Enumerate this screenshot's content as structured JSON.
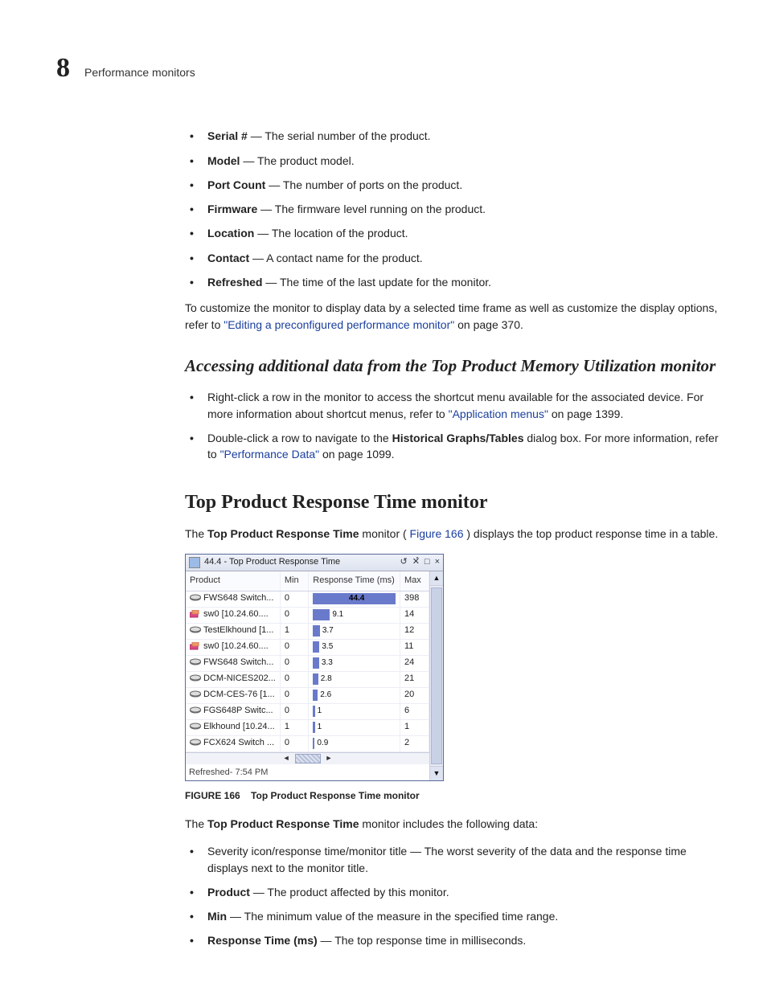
{
  "header": {
    "chapter_number": "8",
    "chapter_title": "Performance monitors"
  },
  "field_list": [
    {
      "term": "Serial #",
      "desc": " — The serial number of the product."
    },
    {
      "term": "Model",
      "desc": " — The product model."
    },
    {
      "term": "Port Count",
      "desc": " — The number of ports on the product."
    },
    {
      "term": "Firmware",
      "desc": " — The firmware level running on the product."
    },
    {
      "term": "Location",
      "desc": " — The location of the product."
    },
    {
      "term": "Contact",
      "desc": " — A contact name for the product."
    },
    {
      "term": "Refreshed",
      "desc": " — The time of the last update for the monitor."
    }
  ],
  "customize_para": {
    "prefix": "To customize the monitor to display data by a selected time frame as well as customize the display options, refer to ",
    "link": "\"Editing a preconfigured performance monitor\"",
    "suffix": " on page 370."
  },
  "accessing_heading": "Accessing additional data from the Top Product Memory Utilization monitor",
  "access_bullets": [
    {
      "prefix": "Right-click a row in the monitor to access the shortcut menu available for the associated device. For more information about shortcut menus, refer to ",
      "link": "\"Application menus\"",
      "suffix": " on page 1399."
    },
    {
      "prefix": "Double-click a row to navigate to the ",
      "bold": "Historical Graphs/Tables",
      "mid": " dialog box. For more information, refer to ",
      "link": "\"Performance Data\"",
      "suffix": " on page 1099."
    }
  ],
  "section_heading": "Top Product Response Time monitor",
  "intro_para": {
    "prefix": "The ",
    "bold": "Top Product Response Time",
    "mid": " monitor (",
    "link": "Figure 166",
    "suffix": ") displays the top product response time in a table."
  },
  "monitor": {
    "title": "44.4 - Top Product Response Time",
    "columns": [
      "Product",
      "Min",
      "Response Time (ms)",
      "Max"
    ],
    "refreshed": "Refreshed- 7:54 PM"
  },
  "chart_data": {
    "type": "table",
    "title": "44.4 - Top Product Response Time",
    "columns": [
      "Product",
      "Min",
      "Response Time (ms)",
      "Max"
    ],
    "rows": [
      {
        "product": "FWS648 Switch...",
        "icon": "stack",
        "min": 0,
        "rt": 44.4,
        "max": 398
      },
      {
        "product": "sw0 [10.24.60....",
        "icon": "nic",
        "min": 0,
        "rt": 9.1,
        "max": 14
      },
      {
        "product": "TestElkhound [1...",
        "icon": "stack",
        "min": 1,
        "rt": 3.7,
        "max": 12
      },
      {
        "product": "sw0 [10.24.60....",
        "icon": "nic",
        "min": 0,
        "rt": 3.5,
        "max": 11
      },
      {
        "product": "FWS648 Switch...",
        "icon": "stack",
        "min": 0,
        "rt": 3.3,
        "max": 24
      },
      {
        "product": "DCM-NICES202...",
        "icon": "stack",
        "min": 0,
        "rt": 2.8,
        "max": 21
      },
      {
        "product": "DCM-CES-76 [1...",
        "icon": "stack",
        "min": 0,
        "rt": 2.6,
        "max": 20
      },
      {
        "product": "FGS648P Switc...",
        "icon": "stack",
        "min": 0,
        "rt": 1,
        "max": 6
      },
      {
        "product": "Elkhound [10.24...",
        "icon": "stack",
        "min": 1,
        "rt": 1,
        "max": 1
      },
      {
        "product": "FCX624 Switch ...",
        "icon": "stack",
        "min": 0,
        "rt": 0.9,
        "max": 2
      }
    ],
    "bar_max": 44.4
  },
  "figure_caption": {
    "label": "FIGURE 166",
    "text": "Top Product Response Time monitor"
  },
  "after_fig_para": {
    "prefix": "The ",
    "bold": "Top Product Response Time",
    "suffix": " monitor includes the following data:"
  },
  "data_points": [
    {
      "term": "",
      "desc": "Severity icon/response time/monitor title — The worst severity of the data and the response time displays next to the monitor title."
    },
    {
      "term": "Product",
      "desc": " — The product affected by this monitor."
    },
    {
      "term": "Min",
      "desc": " — The minimum value of the measure in the specified time range."
    },
    {
      "term": "Response Time (ms)",
      "desc": " — The top response time in milliseconds."
    }
  ]
}
